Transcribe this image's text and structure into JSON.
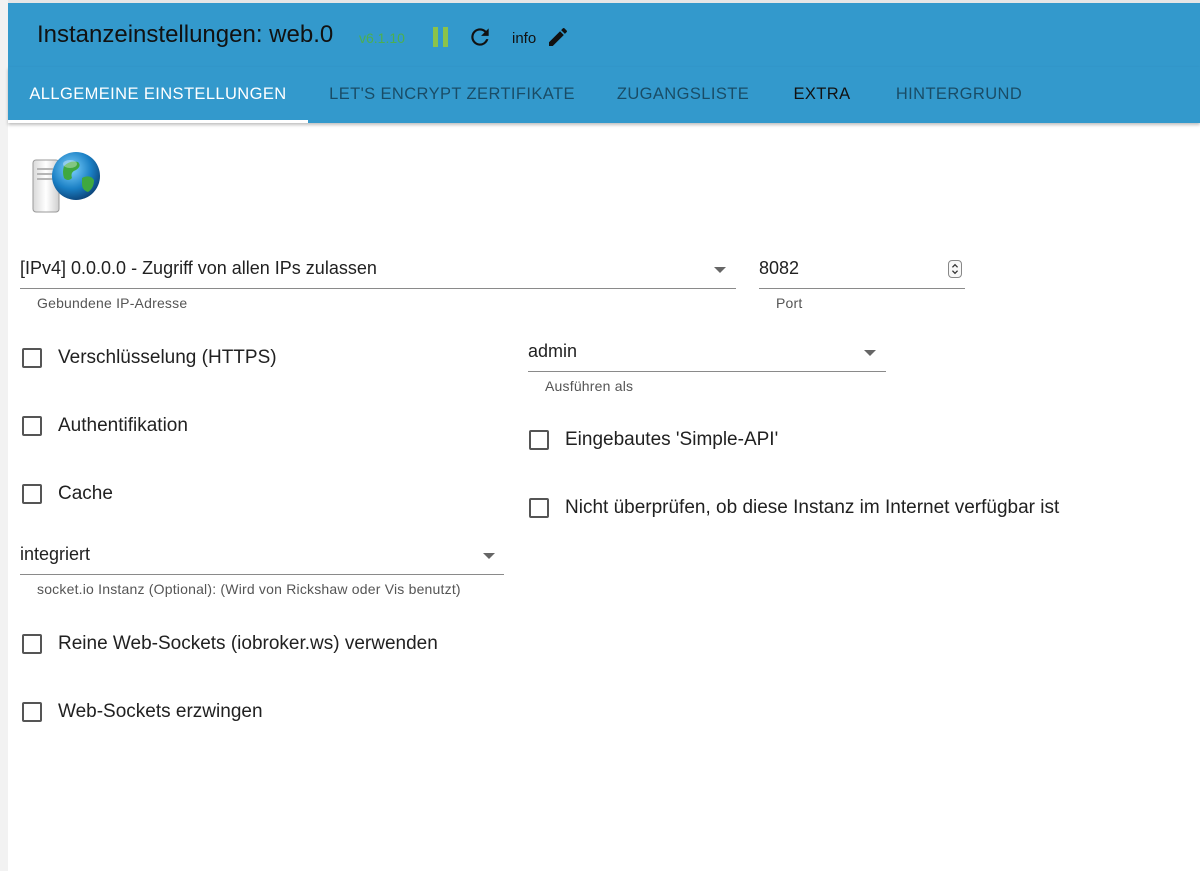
{
  "header": {
    "title": "Instanzeinstellungen: web.0",
    "version": "v6.1.10",
    "info_label": "info",
    "colors": {
      "bar": "#3399cc",
      "version": "#4caf50",
      "pause": "#8bc34a"
    },
    "icons": [
      "pause-icon",
      "reload-icon",
      "edit-pencil-icon"
    ]
  },
  "tabs": [
    {
      "label": "ALLGEMEINE EINSTELLUNGEN",
      "selected": true
    },
    {
      "label": "LET'S ENCRYPT ZERTIFIKATE",
      "selected": false
    },
    {
      "label": "ZUGANGSLISTE",
      "selected": false
    },
    {
      "label": "EXTRA",
      "selected": false
    },
    {
      "label": "HINTERGRUND",
      "selected": false
    }
  ],
  "form": {
    "bind_ip": {
      "value": "[IPv4] 0.0.0.0 - Zugriff von allen IPs zulassen",
      "helper": "Gebundene IP-Adresse"
    },
    "port": {
      "value": "8082",
      "helper": "Port"
    },
    "run_as": {
      "value": "admin",
      "helper": "Ausführen als"
    },
    "socketio": {
      "value": "integriert",
      "helper": "socket.io Instanz (Optional): (Wird von Rickshaw oder Vis benutzt)"
    },
    "checkboxes": {
      "https": {
        "label": "Verschlüsselung (HTTPS)",
        "checked": false
      },
      "auth": {
        "label": "Authentifikation",
        "checked": false
      },
      "cache": {
        "label": "Cache",
        "checked": false
      },
      "simple_api": {
        "label": "Eingebautes 'Simple-API'",
        "checked": false
      },
      "no_check": {
        "label": "Nicht überprüfen, ob diese Instanz im Internet verfügbar ist",
        "checked": false
      },
      "pure_ws": {
        "label": "Reine Web-Sockets (iobroker.ws) verwenden",
        "checked": false
      },
      "force_ws": {
        "label": "Web-Sockets erzwingen",
        "checked": false
      }
    }
  }
}
